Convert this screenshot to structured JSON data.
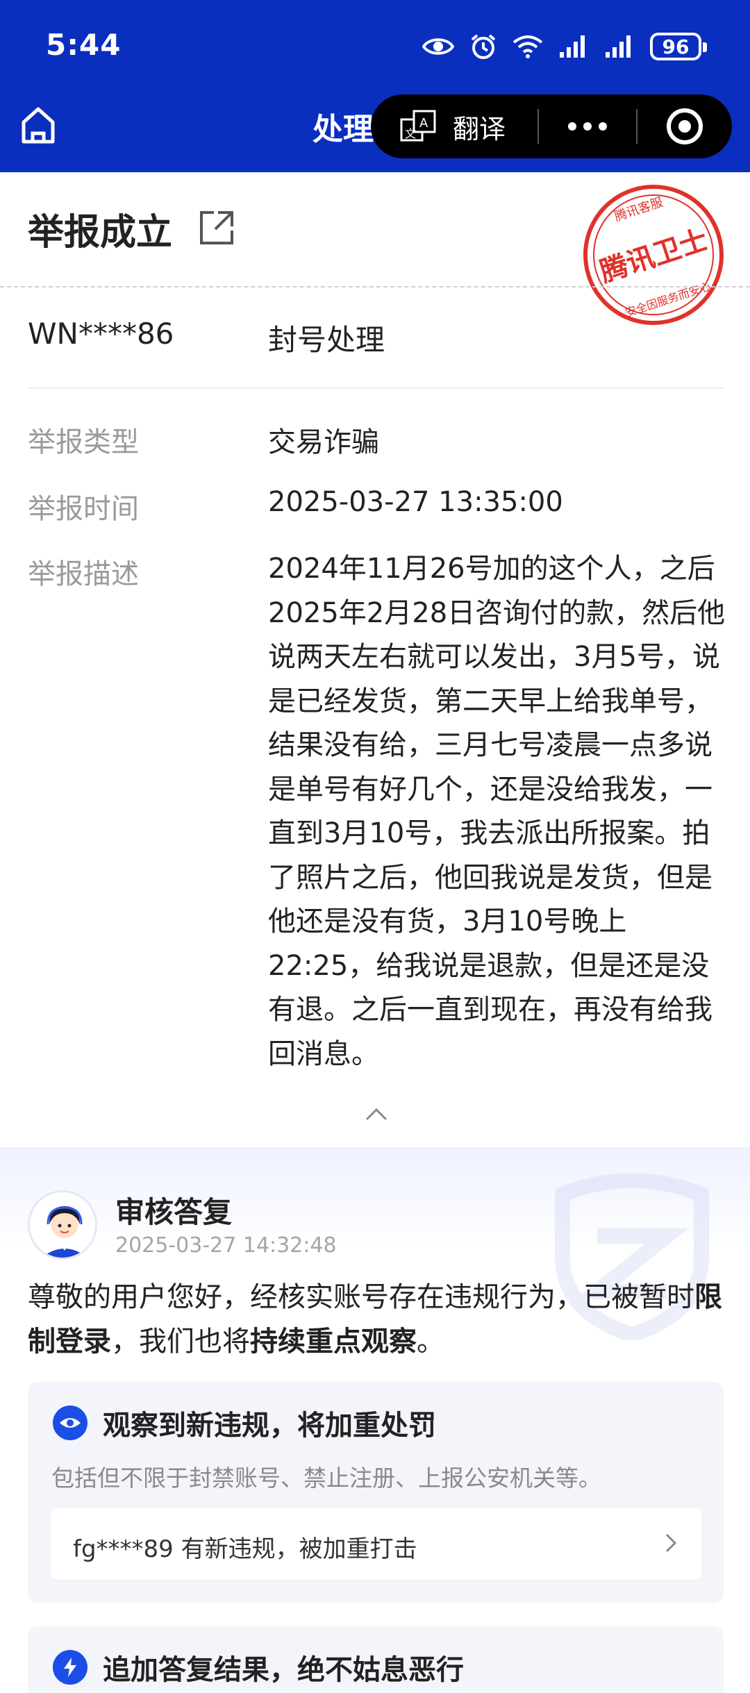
{
  "status_bar": {
    "time": "5:44",
    "battery": "96"
  },
  "nav": {
    "title": "处理",
    "capsule_translate": "翻译"
  },
  "report": {
    "title": "举报成立",
    "stamp_text": "腾讯卫士",
    "stamp_top": "腾讯客服",
    "stamp_bottom": "安全因服务而安心",
    "account": "WN****86",
    "action": "封号处理",
    "type_label": "举报类型",
    "type_value": "交易诈骗",
    "time_label": "举报时间",
    "time_value": "2025-03-27 13:35:00",
    "desc_label": "举报描述",
    "desc_value": "2024年11月26号加的这个人，之后2025年2月28日咨询付的款，然后他说两天左右就可以发出，3月5号，说是已经发货，第二天早上给我单号，结果没有给，三月七号凌晨一点多说是单号有好几个，还是没给我发，一直到3月10号，我去派出所报案。拍了照片之后，他回我说是发货，但是他还是没有货，3月10号晚上22:25，给我说是退款，但是还是没有退。之后一直到现在，再没有给我回消息。"
  },
  "review": {
    "title": "审核答复",
    "time": "2025-03-27 14:32:48",
    "text_1": "尊敬的用户您好，经核实账号存在违规行为，已被暂时",
    "text_bold_1": "限制登录",
    "text_2": "，我们也将",
    "text_bold_2": "持续重点观察",
    "text_3": "。"
  },
  "card1": {
    "title": "观察到新违规，将加重处罚",
    "subtitle": "包括但不限于封禁账号、禁止注册、上报公安机关等。",
    "item": "fg****89 有新违规，被加重打击"
  },
  "card2": {
    "title": "追加答复结果，绝不姑息恶行"
  },
  "colors": {
    "brand_blue": "#0a2fbf",
    "accent_blue": "#1a4ee6",
    "stamp_red": "#e0322a"
  }
}
